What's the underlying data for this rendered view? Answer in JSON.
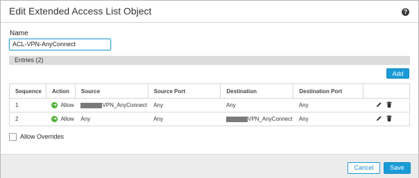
{
  "dialog": {
    "title": "Edit Extended Access List Object",
    "help_icon": "question-icon",
    "help_glyph": "?"
  },
  "form": {
    "name_label": "Name",
    "name_value": "ACL-VPN-AnyConnect",
    "entries_label": "Entries (2)",
    "add_label": "Add",
    "allow_overrides_label": "Allow Overrides",
    "allow_overrides_checked": false
  },
  "table": {
    "columns": [
      "Sequence",
      "Action",
      "Source",
      "Source Port",
      "Destination",
      "Destination Port",
      ""
    ],
    "rows": [
      {
        "sequence": "1",
        "action": "Allow",
        "source": "VPN_AnyConnect",
        "source_redacted": true,
        "source_port": "Any",
        "destination": "Any",
        "destination_redacted": false,
        "destination_port": "Any"
      },
      {
        "sequence": "2",
        "action": "Allow",
        "source": "Any",
        "source_redacted": false,
        "source_port": "Any",
        "destination": "VPN_AnyConnect",
        "destination_redacted": true,
        "destination_port": "Any"
      }
    ],
    "row_icons": [
      "pencil-icon",
      "trash-icon"
    ]
  },
  "footer": {
    "cancel_label": "Cancel",
    "save_label": "Save"
  },
  "colors": {
    "accent": "#1a9bd7",
    "allow": "#4caf35",
    "footer_bg": "#ececec",
    "entries_bar": "#dcdcdc"
  }
}
